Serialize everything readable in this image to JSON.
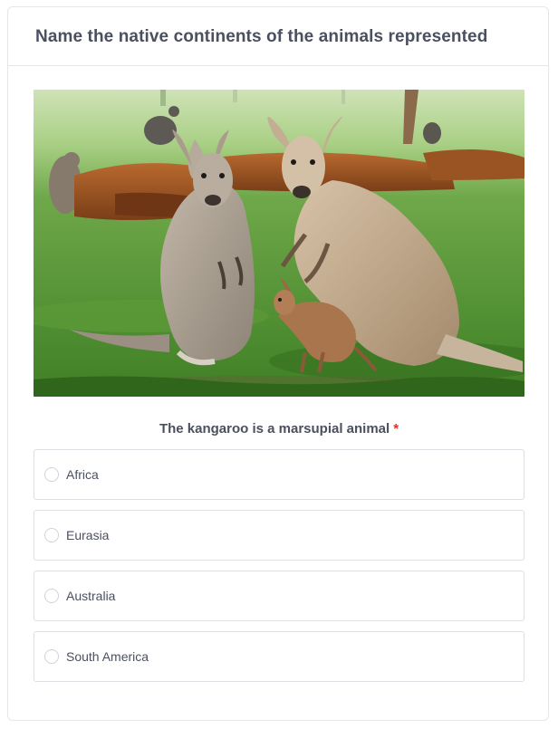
{
  "form": {
    "title": "Name the native continents of the animals represented",
    "image": {
      "subject": "kangaroos"
    },
    "question": {
      "text": "The kangaroo is a marsupial animal",
      "required_marker": "*"
    },
    "options": [
      {
        "label": "Africa",
        "selected": false
      },
      {
        "label": "Eurasia",
        "selected": false
      },
      {
        "label": "Australia",
        "selected": false
      },
      {
        "label": "South America",
        "selected": false
      }
    ]
  },
  "colors": {
    "text": "#4a5060",
    "required": "#e0302a",
    "border": "#dcdfe4",
    "grass": "#4f8e2e"
  }
}
